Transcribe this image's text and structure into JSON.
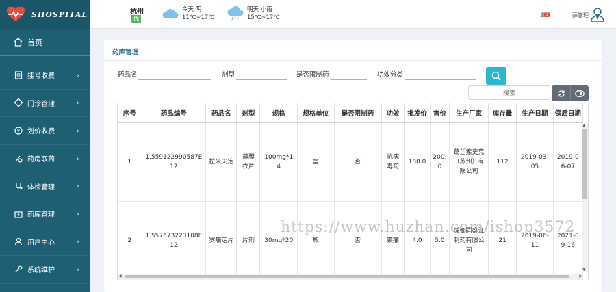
{
  "app": {
    "logo_text": "SHOSPITAL"
  },
  "sidebar": {
    "items": [
      {
        "label": "首页",
        "icon": "home-icon"
      },
      {
        "label": "挂号收费",
        "icon": "register-icon"
      },
      {
        "label": "门诊管理",
        "icon": "clinic-icon"
      },
      {
        "label": "划价收费",
        "icon": "price-icon"
      },
      {
        "label": "药房取药",
        "icon": "pharmacy-icon"
      },
      {
        "label": "体检管理",
        "icon": "checkup-icon"
      },
      {
        "label": "药库管理",
        "icon": "warehouse-icon"
      },
      {
        "label": "用户中心",
        "icon": "user-icon"
      },
      {
        "label": "系统维护",
        "icon": "wrench-icon"
      }
    ]
  },
  "header": {
    "city": "杭州",
    "aqi": "优",
    "weather_today": {
      "label": "今天 阴",
      "temp": "11℃~17℃"
    },
    "weather_tomorrow": {
      "label": "明天 小雨",
      "temp": "15℃~17℃"
    },
    "notification_count": "3",
    "user_name": "薛管理"
  },
  "page": {
    "title": "药库管理",
    "filters": {
      "drug_name_label": "药品名",
      "dosage_form_label": "剂型",
      "restricted_label": "是否限制药",
      "efficacy_label": "功效分类"
    },
    "table_search_placeholder": "搜索"
  },
  "table": {
    "columns": [
      "序号",
      "药品编号",
      "药品名",
      "剂型",
      "规格",
      "规格单位",
      "是否限制药",
      "功效",
      "批发价",
      "售价",
      "生产厂家",
      "库存量",
      "生产日期",
      "保质日期"
    ],
    "rows": [
      [
        "1",
        "1.559122990587E12",
        "拉米夫定",
        "薄膜衣片",
        "100mg*14",
        "盒",
        "否",
        "抗病毒药",
        "180.0",
        "200.0",
        "葛兰素史克（苏州）有限公司",
        "112",
        "2019-03-05",
        "2019-06-07"
      ],
      [
        "2",
        "1.557673223108E12",
        "罗痛定片",
        "片剂",
        "30mg*20",
        "瓶",
        "否",
        "镇痛",
        "4.0",
        "5.0",
        "成都同盛江制药有限公司",
        "21",
        "2019-06-11",
        "2021-09-16"
      ]
    ]
  },
  "watermark": "https://www.huzhan.com/ishop3572",
  "colors": {
    "sidebar": "#1e5f74",
    "accent": "#2ab6cf",
    "aqi": "#5cb85c",
    "badge": "#e74c3c"
  }
}
